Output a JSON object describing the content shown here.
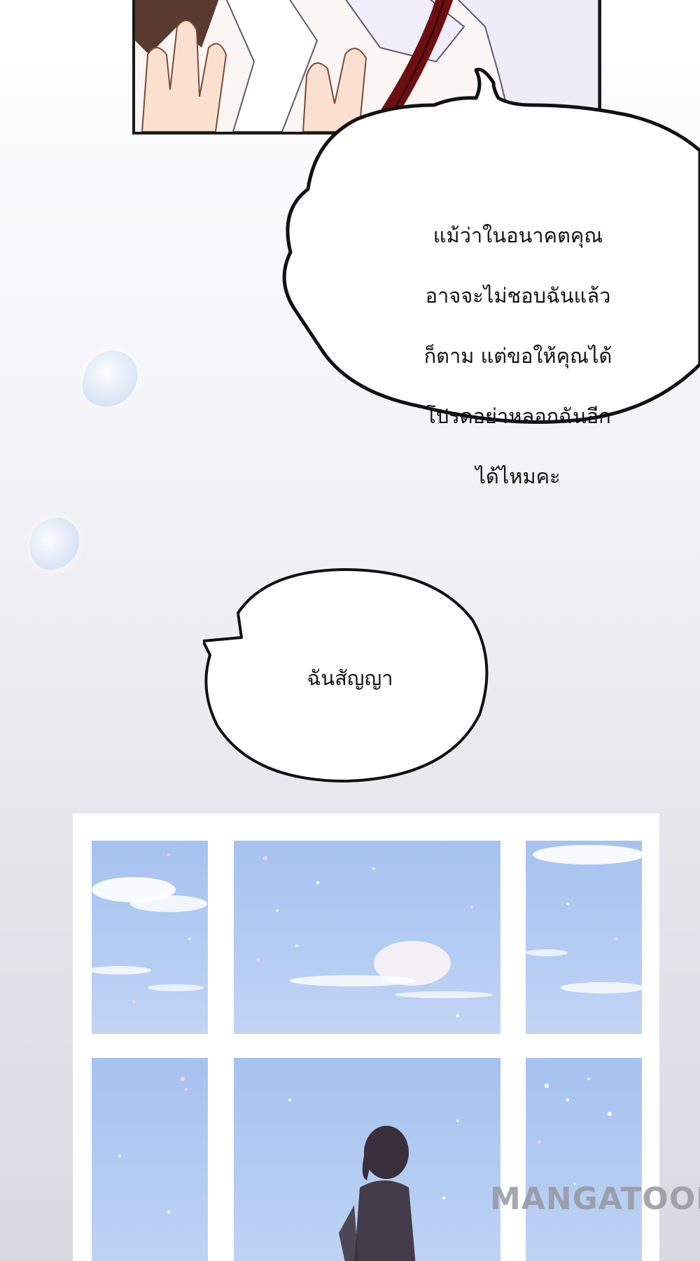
{
  "dialogue": {
    "bubble_1": {
      "lines": [
        "แม้ว่าในอนาคตคุณ",
        "อาจจะไม่ชอบฉันแล้ว",
        "ก็ตาม แต่ขอให้คุณได้",
        "โปรดอย่าหลอกฉันอีก",
        "ได้ไหมคะ"
      ]
    },
    "bubble_2": {
      "text": "ฉันสัญญา"
    }
  },
  "watermark": {
    "text": "MANGATOON"
  },
  "colors": {
    "sky": "#b2cbf2",
    "hair": "#6b0f10",
    "outline": "#111111"
  }
}
